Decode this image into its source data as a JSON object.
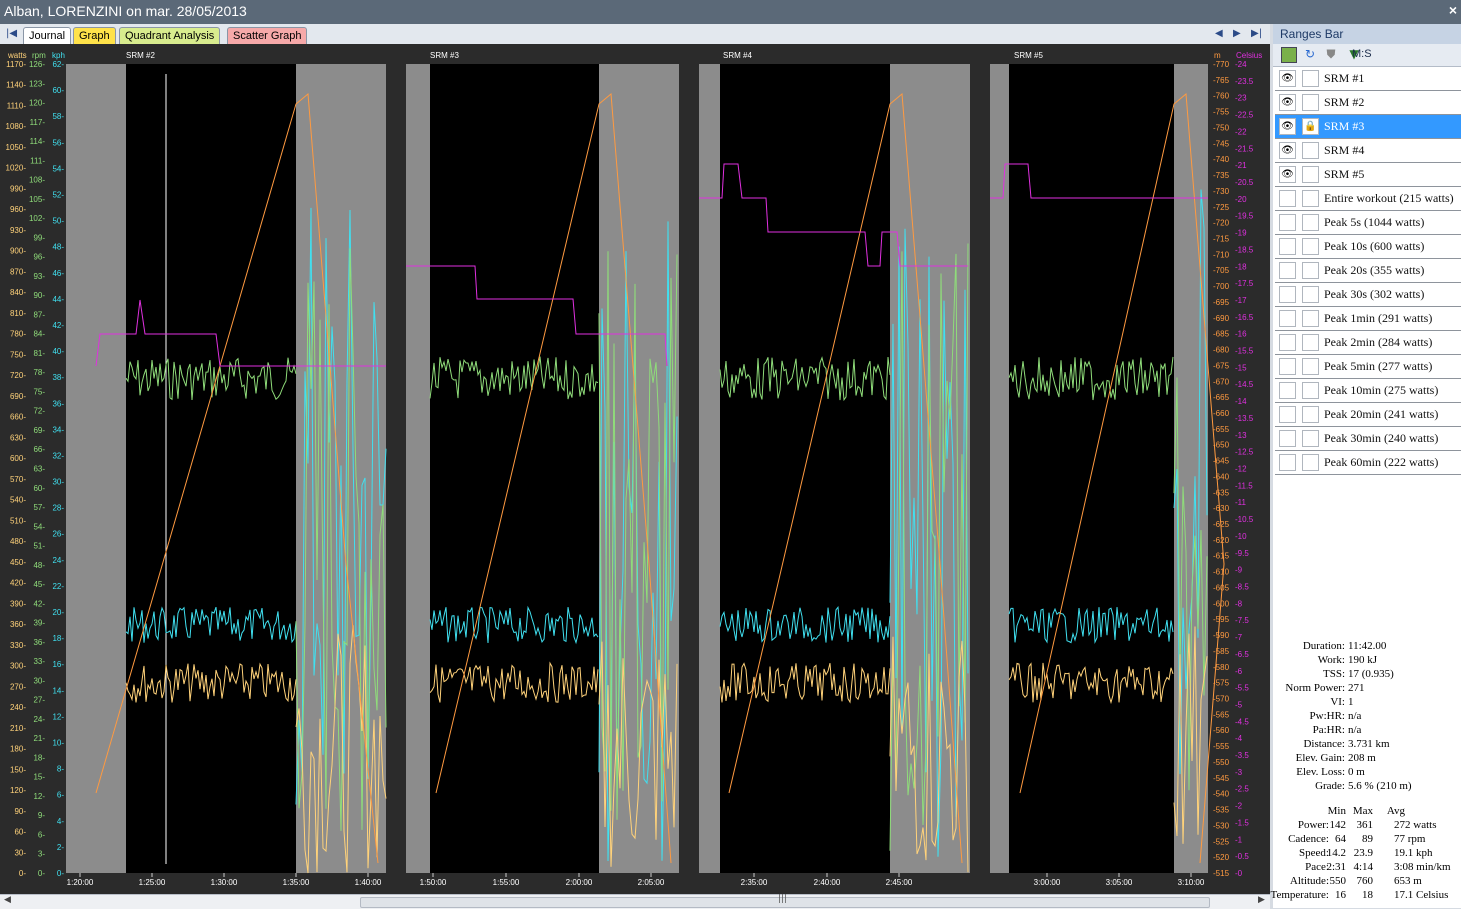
{
  "window": {
    "title": "Alban, LORENZINI on mar. 28/05/2013",
    "close": "×"
  },
  "tabs": [
    {
      "label": "Journal",
      "color": "#ffffff"
    },
    {
      "label": "Graph",
      "color": "#ffe24a"
    },
    {
      "label": "Quadrant Analysis",
      "color": "#d8ec8e"
    },
    {
      "label": "Scatter Graph",
      "color": "#f6a9a9"
    }
  ],
  "nav": {
    "first": "|◀",
    "prev": "◀",
    "next": "▶",
    "last": "▶|"
  },
  "axes": {
    "units": {
      "watts": "watts",
      "rpm": "rpm",
      "kph": "kph",
      "m": "m",
      "celsius": "Celsius"
    },
    "watts_ticks": [
      "1170-",
      "1140-",
      "1110-",
      "1080-",
      "1050-",
      "1020-",
      "990-",
      "960-",
      "930-",
      "900-",
      "870-",
      "840-",
      "810-",
      "780-",
      "750-",
      "720-",
      "690-",
      "660-",
      "630-",
      "600-",
      "570-",
      "540-",
      "510-",
      "480-",
      "450-",
      "420-",
      "390-",
      "360-",
      "330-",
      "300-",
      "270-",
      "240-",
      "210-",
      "180-",
      "150-",
      "120-",
      "90-",
      "60-",
      "30-",
      "0-"
    ],
    "rpm_ticks": [
      "126-",
      "123-",
      "120-",
      "117-",
      "114-",
      "111-",
      "108-",
      "105-",
      "102-",
      "99-",
      "96-",
      "93-",
      "90-",
      "87-",
      "84-",
      "81-",
      "78-",
      "75-",
      "72-",
      "69-",
      "66-",
      "63-",
      "60-",
      "57-",
      "54-",
      "51-",
      "48-",
      "45-",
      "42-",
      "39-",
      "36-",
      "33-",
      "30-",
      "27-",
      "24-",
      "21-",
      "18-",
      "15-",
      "12-",
      "9-",
      "6-",
      "3-",
      "0-"
    ],
    "kph_ticks": [
      "62-",
      "60-",
      "58-",
      "56-",
      "54-",
      "52-",
      "50-",
      "48-",
      "46-",
      "44-",
      "42-",
      "40-",
      "38-",
      "36-",
      "34-",
      "32-",
      "30-",
      "28-",
      "26-",
      "24-",
      "22-",
      "20-",
      "18-",
      "16-",
      "14-",
      "12-",
      "10-",
      "8-",
      "6-",
      "4-",
      "2-",
      "0-"
    ],
    "m_ticks": [
      "-770",
      "-765",
      "-760",
      "-755",
      "-750",
      "-745",
      "-740",
      "-735",
      "-730",
      "-725",
      "-720",
      "-715",
      "-710",
      "-705",
      "-700",
      "-695",
      "-690",
      "-685",
      "-680",
      "-675",
      "-670",
      "-665",
      "-660",
      "-655",
      "-650",
      "-645",
      "-640",
      "-635",
      "-630",
      "-625",
      "-620",
      "-615",
      "-610",
      "-605",
      "-600",
      "-595",
      "-590",
      "-585",
      "-580",
      "-575",
      "-570",
      "-565",
      "-560",
      "-555",
      "-550",
      "-545",
      "-540",
      "-535",
      "-530",
      "-525",
      "-520",
      "-515"
    ],
    "celsius_ticks": [
      "-24",
      "-23.5",
      "-23",
      "-22.5",
      "-22",
      "-21.5",
      "-21",
      "-20.5",
      "-20",
      "-19.5",
      "-19",
      "-18.5",
      "-18",
      "-17.5",
      "-17",
      "-16.5",
      "-16",
      "-15.5",
      "-15",
      "-14.5",
      "-14",
      "-13.5",
      "-13",
      "-12.5",
      "-12",
      "-11.5",
      "-11",
      "-10.5",
      "-10",
      "-9.5",
      "-9",
      "-8.5",
      "-8",
      "-7.5",
      "-7",
      "-6.5",
      "-6",
      "-5.5",
      "-5",
      "-4.5",
      "-4",
      "-3.5",
      "-3",
      "-2.5",
      "-2",
      "-1.5",
      "-1",
      "-0.5",
      "-0"
    ],
    "time_ticks": [
      "1:20:00",
      "1:25:00",
      "1:30:00",
      "1:35:00",
      "1:40:00",
      "1:50:00",
      "1:55:00",
      "2:00:00",
      "2:05:00",
      "2:35:00",
      "2:40:00",
      "2:45:00",
      "3:00:00",
      "3:05:00",
      "3:10:00"
    ]
  },
  "segments": [
    {
      "label": "SRM #2"
    },
    {
      "label": "SRM #3"
    },
    {
      "label": "SRM #4"
    },
    {
      "label": "SRM #5"
    }
  ],
  "series_colors": {
    "power": "#ffd27a",
    "cadence": "#8fdc7a",
    "speed": "#40e0f0",
    "altitude": "#ff9a40",
    "temperature": "#e030e0"
  },
  "ranges_bar": {
    "title": "Ranges Bar",
    "toolbar_label": "M:S",
    "items": [
      {
        "label": "SRM #1",
        "eye": true,
        "lock": false,
        "selected": false
      },
      {
        "label": "SRM #2",
        "eye": true,
        "lock": false,
        "selected": false
      },
      {
        "label": "SRM #3",
        "eye": true,
        "lock": true,
        "selected": true
      },
      {
        "label": "SRM #4",
        "eye": true,
        "lock": false,
        "selected": false
      },
      {
        "label": "SRM #5",
        "eye": true,
        "lock": false,
        "selected": false
      },
      {
        "label": "Entire workout (215 watts)",
        "eye": false,
        "lock": false,
        "selected": false
      },
      {
        "label": "Peak 5s (1044 watts)",
        "eye": false,
        "lock": false,
        "selected": false
      },
      {
        "label": "Peak 10s (600 watts)",
        "eye": false,
        "lock": false,
        "selected": false
      },
      {
        "label": "Peak 20s (355 watts)",
        "eye": false,
        "lock": false,
        "selected": false
      },
      {
        "label": "Peak 30s (302 watts)",
        "eye": false,
        "lock": false,
        "selected": false
      },
      {
        "label": "Peak 1min (291 watts)",
        "eye": false,
        "lock": false,
        "selected": false
      },
      {
        "label": "Peak 2min (284 watts)",
        "eye": false,
        "lock": false,
        "selected": false
      },
      {
        "label": "Peak 5min (277 watts)",
        "eye": false,
        "lock": false,
        "selected": false
      },
      {
        "label": "Peak 10min (275 watts)",
        "eye": false,
        "lock": false,
        "selected": false
      },
      {
        "label": "Peak 20min (241 watts)",
        "eye": false,
        "lock": false,
        "selected": false
      },
      {
        "label": "Peak 30min (240 watts)",
        "eye": false,
        "lock": false,
        "selected": false
      },
      {
        "label": "Peak 60min (222 watts)",
        "eye": false,
        "lock": false,
        "selected": false
      }
    ]
  },
  "summary": {
    "rows": [
      {
        "label": "Duration:",
        "value": "11:42.00"
      },
      {
        "label": "Work:",
        "value": "190 kJ"
      },
      {
        "label": "TSS:",
        "value": "17 (0.935)"
      },
      {
        "label": "Norm Power:",
        "value": "271"
      },
      {
        "label": "VI:",
        "value": "1"
      },
      {
        "label": "Pw:HR:",
        "value": "n/a"
      },
      {
        "label": "Pa:HR:",
        "value": "n/a"
      },
      {
        "label": "Distance:",
        "value": "3.731 km"
      },
      {
        "label": "Elev. Gain:",
        "value": "208 m"
      },
      {
        "label": "Elev. Loss:",
        "value": "0 m"
      },
      {
        "label": "Grade:",
        "value": "5.6 % (210 m)"
      }
    ],
    "table_header": {
      "min": "Min",
      "max": "Max",
      "avg": "Avg"
    },
    "table": [
      {
        "label": "Power:",
        "min": "142",
        "max": "361",
        "avg": "272 watts"
      },
      {
        "label": "Cadence:",
        "min": "64",
        "max": "89",
        "avg": "77 rpm"
      },
      {
        "label": "Speed:",
        "min": "14.2",
        "max": "23.9",
        "avg": "19.1 kph"
      },
      {
        "label": "Pace:",
        "min": "2:31",
        "max": "4:14",
        "avg": "3:08 min/km"
      },
      {
        "label": "Altitude:",
        "min": "550",
        "max": "760",
        "avg": "653 m"
      },
      {
        "label": "Temperature:",
        "min": "16",
        "max": "18",
        "avg": "17.1 Celsius"
      }
    ]
  }
}
